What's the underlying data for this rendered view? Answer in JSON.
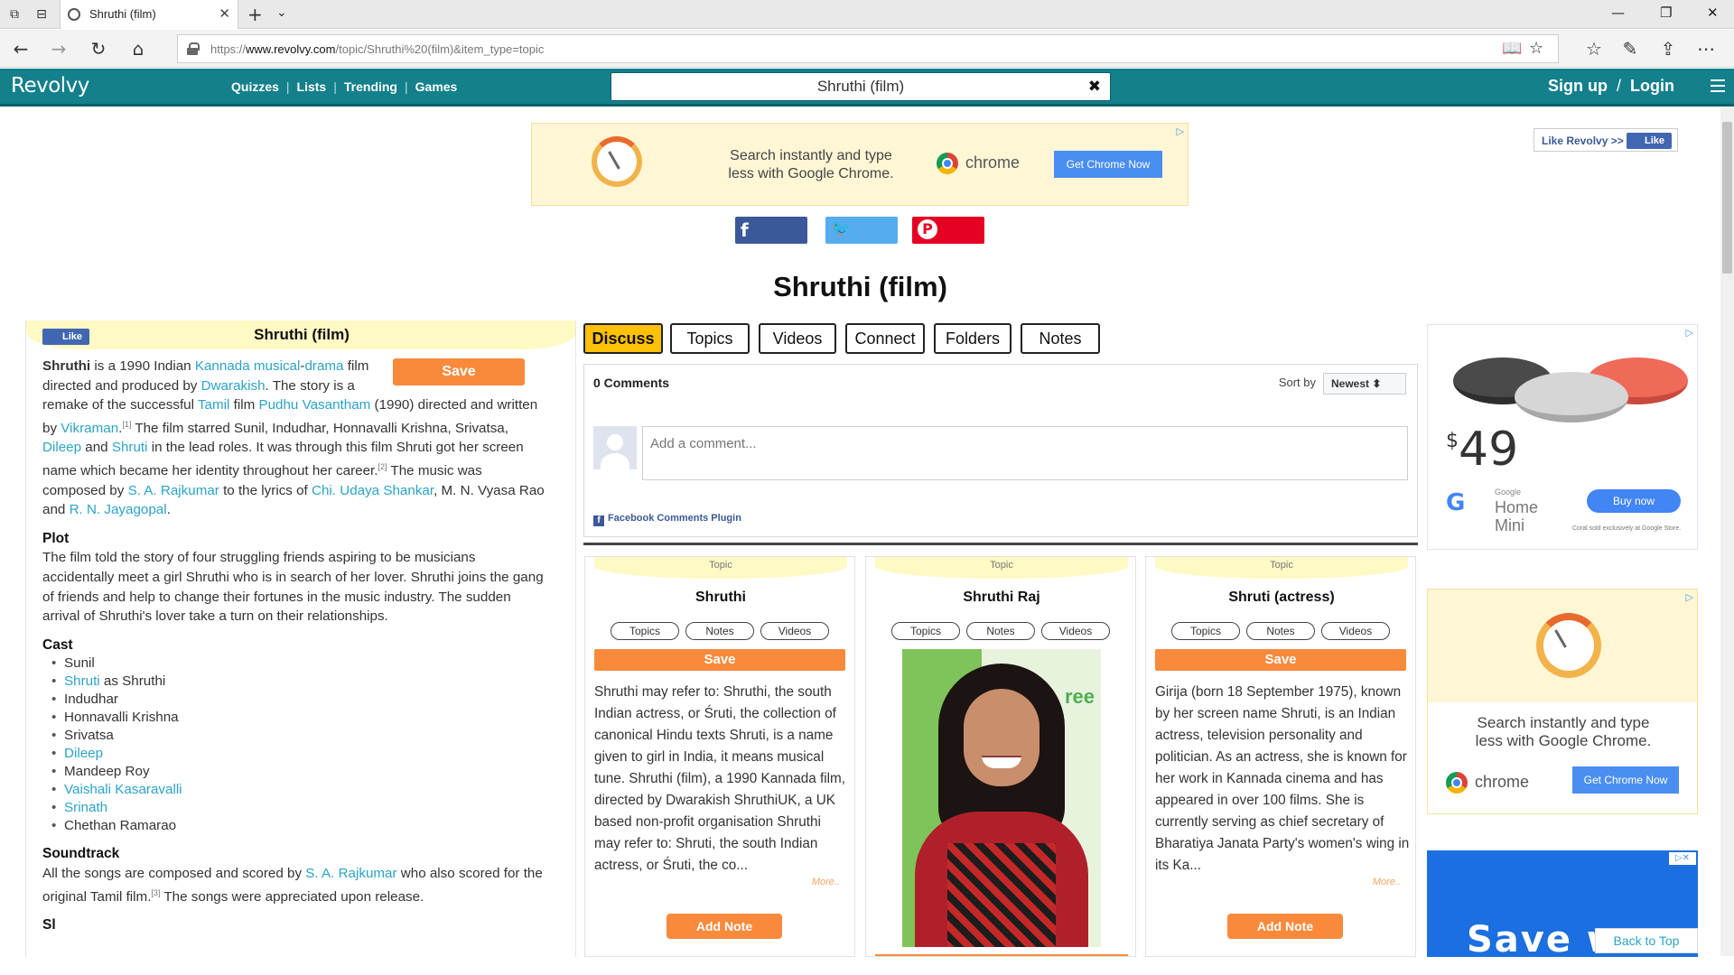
{
  "browser": {
    "tab_title": "Shruthi (film)",
    "url_prefix": "https://",
    "url_host": "www.revolvy.com",
    "url_path": "/topic/Shruthi%20(film)&item_type=topic"
  },
  "site": {
    "logo": "Revolvy",
    "nav": [
      "Quizzes",
      "Lists",
      "Trending",
      "Games"
    ],
    "search_value": "Shruthi (film)",
    "signup": "Sign up",
    "login": "Login"
  },
  "ad_top": {
    "line1": "Search instantly and type",
    "line2": "less with Google Chrome.",
    "brand": "chrome",
    "cta": "Get Chrome Now"
  },
  "like_revolvy": {
    "label": "Like Revolvy >>",
    "like": "Like"
  },
  "page_title": "Shruthi (film)",
  "article": {
    "title": "Shruthi (film)",
    "like": "Like",
    "save": "Save",
    "plot_heading": "Plot",
    "plot_text": "The film told the story of four struggling friends aspiring to be musicians accidentally meet a girl Shruthi who is in search of her lover. Shruthi joins the gang of friends and help to change their fortunes in the music industry. The sudden arrival of Shruthi's lover take a turn on their relationships.",
    "cast_heading": "Cast",
    "cast": [
      {
        "name": "Sunil",
        "link": false,
        "suffix": ""
      },
      {
        "name": "Shruti",
        "link": true,
        "suffix": " as Shruthi"
      },
      {
        "name": "Indudhar",
        "link": false,
        "suffix": ""
      },
      {
        "name": "Honnavalli Krishna",
        "link": false,
        "suffix": ""
      },
      {
        "name": "Srivatsa",
        "link": false,
        "suffix": ""
      },
      {
        "name": "Dileep",
        "link": true,
        "suffix": ""
      },
      {
        "name": "Mandeep Roy",
        "link": false,
        "suffix": ""
      },
      {
        "name": "Vaishali Kasaravalli",
        "link": true,
        "suffix": ""
      },
      {
        "name": "Srinath",
        "link": true,
        "suffix": ""
      },
      {
        "name": "Chethan Ramarao",
        "link": false,
        "suffix": ""
      }
    ],
    "soundtrack_heading": "Soundtrack",
    "soundtrack_pre": "All the songs are composed and scored by ",
    "soundtrack_link": "S. A. Rajkumar",
    "soundtrack_post": " who also scored for the original Tamil film.",
    "soundtrack_ref": "[3]",
    "soundtrack_end": " The songs were appreciated upon release.",
    "next_heading": "Sl"
  },
  "tabs": [
    "Discuss",
    "Topics",
    "Videos",
    "Connect",
    "Folders",
    "Notes"
  ],
  "comments": {
    "count": "0 Comments",
    "sort_label": "Sort by",
    "sort_value": "Newest ⬍",
    "placeholder": "Add a comment...",
    "plugin": "Facebook Comments Plugin"
  },
  "cards": [
    {
      "topic": "Topic",
      "title": "Shruthi",
      "pills": [
        "Topics",
        "Notes",
        "Videos"
      ],
      "save": "Save",
      "text": "Shruthi may refer to: Shruthi, the south Indian actress, or Śruti, the collection of canonical Hindu texts Shruti, is a name given to girl in India, it means musical tune. Shruthi (film), a 1990 Kannada film, directed by Dwarakish ShruthiUK, a UK based non-profit organisation Shruthi may refer to: Shruti, the south Indian actress, or Śruti, the co...",
      "more": "More..",
      "add_note": "Add Note"
    },
    {
      "topic": "Topic",
      "title": "Shruthi Raj",
      "pills": [
        "Topics",
        "Notes",
        "Videos"
      ],
      "photo_text": "ree"
    },
    {
      "topic": "Topic",
      "title": "Shruti (actress)",
      "pills": [
        "Topics",
        "Notes",
        "Videos"
      ],
      "save": "Save",
      "text": "Girija (born 18 September 1975), known by her screen name Shruti, is an Indian actress, television personality and politician. As an actress, she is known for her work in Kannada cinema and has appeared in over 100 films. She is currently serving as chief secretary of Bharatiya Janata Party's women's wing in its Ka...",
      "more": "More..",
      "add_note": "Add Note"
    }
  ],
  "ad_right1": {
    "price": "49",
    "currency": "$",
    "google_small": "Google",
    "product_line1": "Home",
    "product_line2": "Mini",
    "cta": "Buy now",
    "fine": "Coral sold exclusively at Google Store."
  },
  "ad_right2": {
    "line1": "Search instantly and type",
    "line2": "less with Google Chrome.",
    "brand": "chrome",
    "cta": "Get Chrome Now"
  },
  "ad_right3": {
    "text": "Save w"
  },
  "back_to_top": "Back to Top",
  "colors": {
    "teal": "#13808c",
    "orange": "#f98a3c",
    "yellow": "#ffc107",
    "link": "#2aa3c7"
  }
}
